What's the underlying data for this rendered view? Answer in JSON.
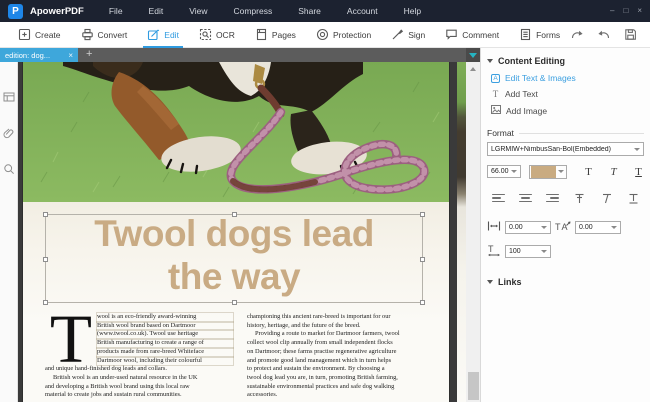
{
  "colors": {
    "accent": "#2f9be0",
    "active_tab": "#3ea7db"
  },
  "titlebar": {
    "logo_letter": "P",
    "app_name": "ApowerPDF",
    "menus": [
      "File",
      "Edit",
      "View",
      "Compress",
      "Share",
      "Account",
      "Help"
    ],
    "window_controls": {
      "minimize": "–",
      "maximize": "□",
      "close": "×"
    }
  },
  "toolbar": {
    "items": [
      {
        "label": "Create"
      },
      {
        "label": "Convert"
      },
      {
        "label": "Edit",
        "active": true
      },
      {
        "label": "OCR"
      },
      {
        "label": "Pages"
      },
      {
        "label": "Protection"
      },
      {
        "label": "Sign"
      },
      {
        "label": "Comment"
      },
      {
        "label": "Forms"
      }
    ],
    "right_icons": [
      "redo",
      "undo",
      "save",
      "account",
      "settings"
    ]
  },
  "tabbar": {
    "active_tab_label": "edition: dog...",
    "close_glyph": "×",
    "new_tab_glyph": "+"
  },
  "right_panel": {
    "content_editing": {
      "title": "Content Editing",
      "items": [
        {
          "label": "Edit Text & Images",
          "icon_letter": "A",
          "active": true
        },
        {
          "label": "Add Text",
          "icon_letter": "T"
        },
        {
          "label": "Add Image"
        }
      ]
    },
    "format": {
      "title": "Format",
      "font_name": "LGRMIW+NimbusSan-Bol(Embedded)",
      "font_size": "66.00",
      "font_color": "#c9ab81",
      "style_buttons": [
        "T",
        "T",
        "T"
      ],
      "char_spacing": "0.00",
      "word_spacing": "0.00",
      "horizontal_scale": "100"
    },
    "links": {
      "title": "Links"
    }
  },
  "document": {
    "headline_line1": "Twool dogs lead",
    "headline_line2": "the way",
    "headline_color": "#c9ab84",
    "dropcap": "T",
    "left_column": {
      "lines": [
        "wool is an eco-friendly award-winning",
        "British wool brand based on Dartmoor",
        "(www.twool.co.uk). Twool use heritage",
        "British manufacturing to create a range of",
        "products made from rare-breed Whiteface",
        "Dartmoor wool, including their colourful",
        "and unique hand-finished dog leads and collars.",
        "British wool is an under-used natural resource in the UK",
        "and developing a British wool brand using this local raw",
        "material to create jobs and sustain rural communities."
      ]
    },
    "right_column": {
      "lines": [
        "championing this ancient rare-breed is important for our",
        "history, heritage, and the future of the breed.",
        "Providing a route to market for Dartmoor farmers, twool",
        "collect wool clip annually from small independent flocks",
        "on Dartmoor; these farms practise regenerative agriculture",
        "and promote good land management which in turn helps",
        "to protect and sustain the environment. By choosing a",
        "twool dog lead you are, in turn, promoting British farming,",
        "sustainable environmental practices and safe dog walking",
        "accessories."
      ]
    }
  }
}
